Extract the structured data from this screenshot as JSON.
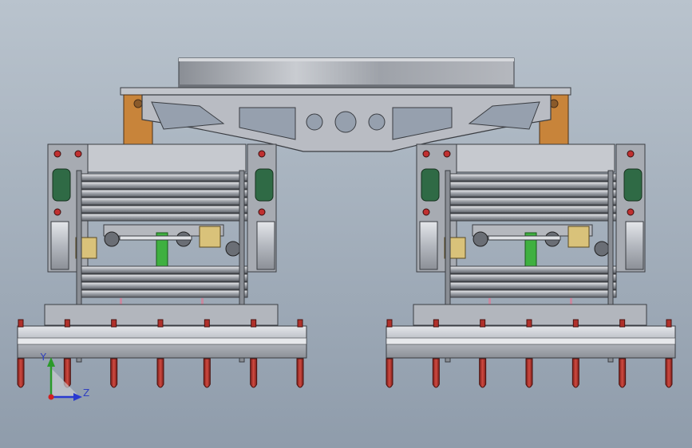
{
  "viewport": {
    "background_top": "#b9c3cd",
    "background_bottom": "#8f9cab"
  },
  "triad": {
    "y_label": "Y",
    "z_label": "Z",
    "y_color": "#2a9a2a",
    "z_color": "#2a3ad0",
    "x_color": "#d02020"
  },
  "colors": {
    "steel": "#b8bcc4",
    "steel_dark": "#7b8088",
    "rail": "#c9ccd2",
    "orange": "#c8843a",
    "green_bearing": "#2f6a45",
    "green_shaft": "#3fb040",
    "red_tooth": "#b0302a",
    "yellow_block": "#d9c27a",
    "disk": "#9a9ea6"
  },
  "machine": {
    "module_count": 2,
    "tooth_count_per_module": 7
  }
}
